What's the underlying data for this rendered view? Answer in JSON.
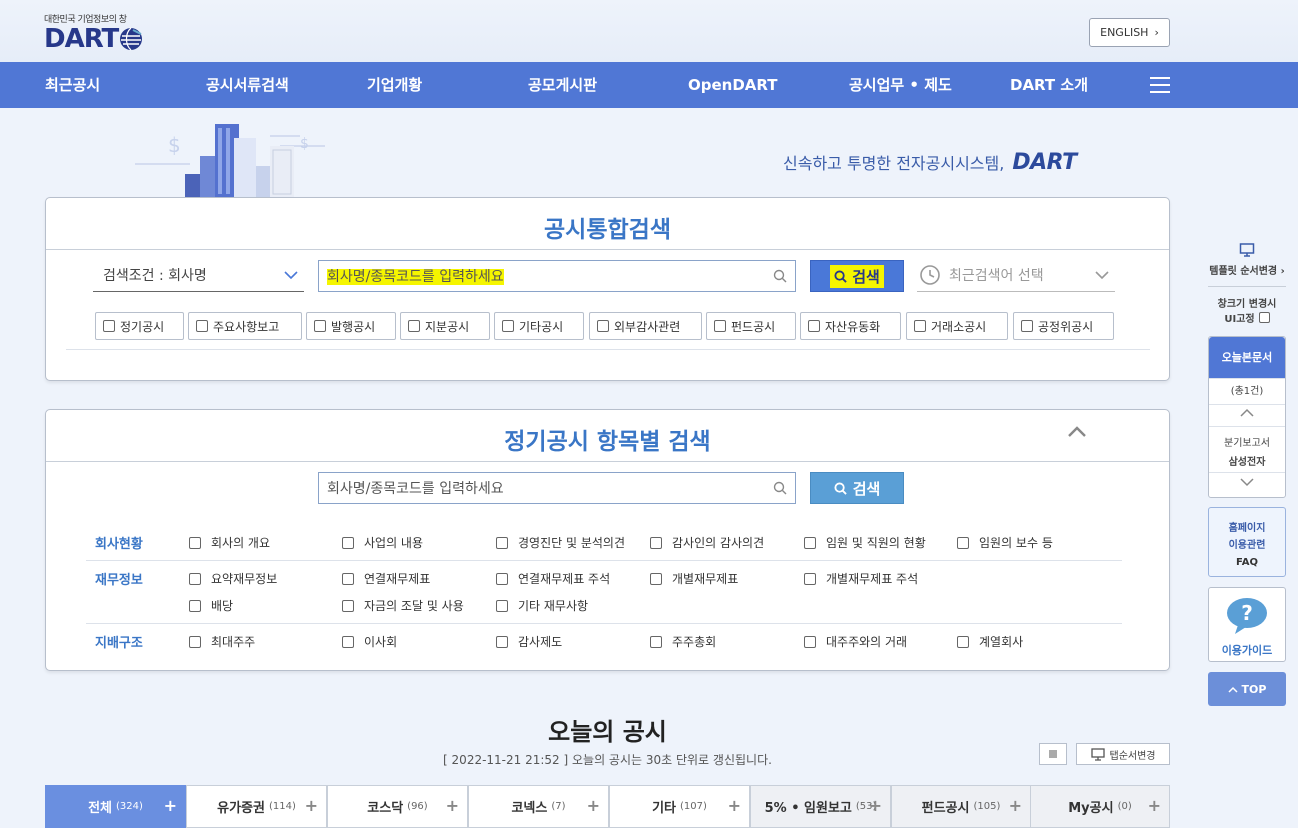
{
  "header": {
    "logo_sub": "대한민국 기업정보의 창",
    "logo_text": "DART",
    "english_label": "ENGLISH"
  },
  "nav": [
    "최근공시",
    "공시서류검색",
    "기업개황",
    "공모게시판",
    "OpenDART",
    "공시업무 • 제도",
    "DART 소개"
  ],
  "tagline": {
    "text": "신속하고 투명한 전자공시시스템,",
    "brand": "DART"
  },
  "integrated_search": {
    "title": "공시통합검색",
    "condition": "검색조건 : 회사명",
    "placeholder": "회사명/종목코드를 입력하세요",
    "search_label": "검색",
    "recent_label": "최근검색어 선택",
    "checkboxes": [
      "정기공시",
      "주요사항보고",
      "발행공시",
      "지분공시",
      "기타공시",
      "외부감사관련",
      "펀드공시",
      "자산유동화",
      "거래소공시",
      "공정위공시"
    ]
  },
  "periodic_search": {
    "title": "정기공시 항목별 검색",
    "placeholder": "회사명/종목코드를 입력하세요",
    "search_label": "검색",
    "rows": [
      {
        "label": "회사현황",
        "items": [
          "회사의 개요",
          "사업의 내용",
          "경영진단 및 분석의견",
          "감사인의 감사의견",
          "임원 및 직원의 현황",
          "임원의 보수 등"
        ]
      },
      {
        "label": "재무정보",
        "items": [
          "요약재무정보",
          "연결재무제표",
          "연결재무제표 주석",
          "개별재무제표",
          "개별재무제표 주석",
          "배당",
          "자금의 조달 및 사용",
          "기타 재무사항"
        ]
      },
      {
        "label": "지배구조",
        "items": [
          "최대주주",
          "이사회",
          "감사제도",
          "주주총회",
          "대주주와의 거래",
          "계열회사"
        ]
      }
    ]
  },
  "quick_menu": {
    "template_label": "템플릿 순서변경",
    "window_label_1": "창크기 변경시",
    "window_label_2": "UI고정",
    "today_docs": "오늘본문서",
    "total": "(총1건)",
    "doc_type": "분기보고서",
    "doc_company": "삼성전자",
    "help_1": "홈페이지",
    "help_2": "이용관련",
    "faq": "FAQ",
    "guide": "이용가이드",
    "top": "TOP"
  },
  "today": {
    "title": "오늘의 공시",
    "subtitle": "[ 2022-11-21 21:52 ] 오늘의 공시는 30초 단위로 갱신됩니다.",
    "tab_change": "탭순서변경",
    "tabs": [
      {
        "label": "전체",
        "count": "(324)"
      },
      {
        "label": "유가증권",
        "count": "(114)"
      },
      {
        "label": "코스닥",
        "count": "(96)"
      },
      {
        "label": "코넥스",
        "count": "(7)"
      },
      {
        "label": "기타",
        "count": "(107)"
      },
      {
        "label": "5% • 임원보고",
        "count": "(53)"
      },
      {
        "label": "펀드공시",
        "count": "(105)"
      },
      {
        "label": "My공시",
        "count": "(0)"
      }
    ]
  },
  "colors": {
    "nav": "#5077d5",
    "accent": "#3a76c6",
    "search_btn": "#4a78d8",
    "search_btn2": "#5a9fd6",
    "highlight": "#f5f500"
  }
}
